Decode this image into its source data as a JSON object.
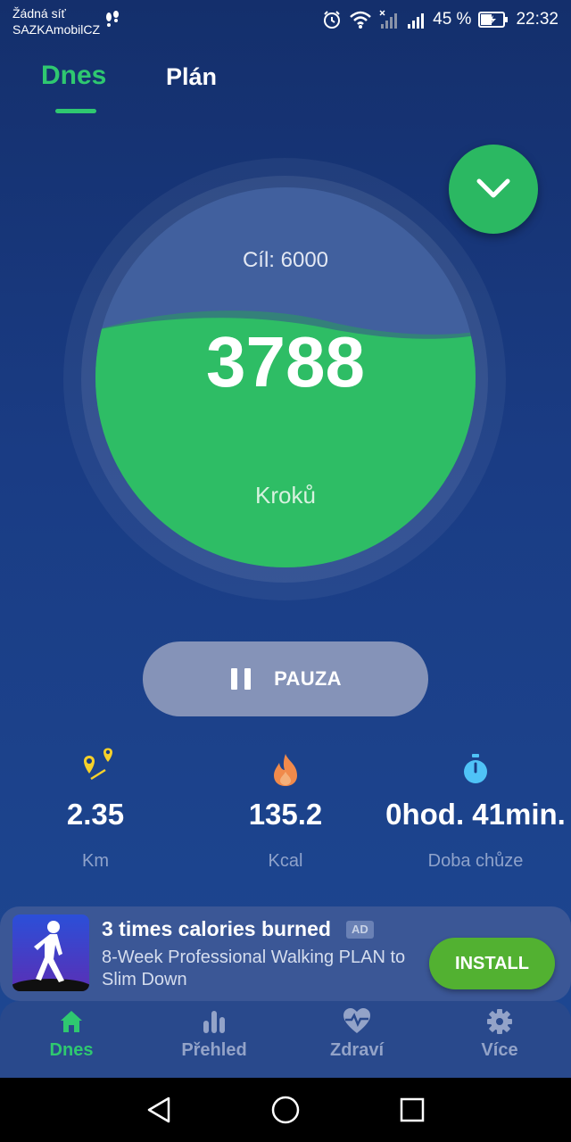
{
  "status_bar": {
    "carrier_line1": "Žádná síť",
    "carrier_line2": "SAZKAmobilCZ",
    "battery_percent": "45 %",
    "time": "22:32"
  },
  "tabs": [
    {
      "label": "Dnes",
      "active": true
    },
    {
      "label": "Plán",
      "active": false
    }
  ],
  "dial": {
    "goal_label": "Cíl: 6000",
    "steps": "3788",
    "steps_unit": "Kroků",
    "goal_steps": 6000,
    "fill_color": "#2ebd65"
  },
  "pause_button": {
    "label": "PAUZA"
  },
  "stats": [
    {
      "icon": "map-pin-route-icon",
      "value": "2.35",
      "label": "Km"
    },
    {
      "icon": "flame-icon",
      "value": "135.2",
      "label": "Kcal"
    },
    {
      "icon": "stopwatch-icon",
      "value": "0hod. 41min.",
      "label": "Doba chůze"
    }
  ],
  "ad": {
    "title": "3 times calories burned",
    "badge": "AD",
    "description": "8-Week Professional Walking PLAN to Slim Down",
    "install_label": "INSTALL"
  },
  "bottom_nav": [
    {
      "icon": "home-icon",
      "label": "Dnes",
      "active": true
    },
    {
      "icon": "bar-chart-icon",
      "label": "Přehled",
      "active": false
    },
    {
      "icon": "heart-pulse-icon",
      "label": "Zdraví",
      "active": false
    },
    {
      "icon": "gear-icon",
      "label": "Více",
      "active": false
    }
  ],
  "colors": {
    "accent_green": "#2fc870",
    "background_top": "#142f6c",
    "background_bottom": "#1e4994"
  }
}
